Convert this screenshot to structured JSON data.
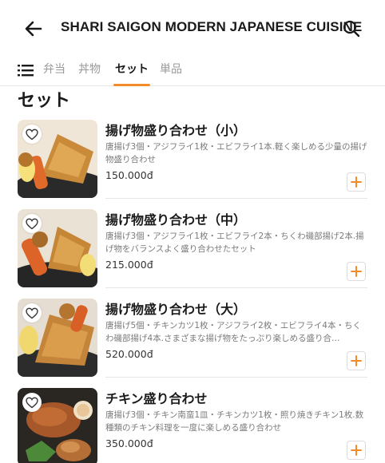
{
  "header": {
    "title": "SHARI SAIGON MODERN JAPANESE CUISINE",
    "back_icon": "arrow-left-icon",
    "search_icon": "search-icon"
  },
  "tabs": {
    "menu_icon": "list-menu-icon",
    "items": [
      {
        "label": "弁当",
        "active": false
      },
      {
        "label": "丼物",
        "active": false
      },
      {
        "label": "セット",
        "active": true
      },
      {
        "label": "単品",
        "active": false
      }
    ]
  },
  "accent_color": "#f28c28",
  "section": {
    "title": "セット",
    "items": [
      {
        "name": "揚げ物盛り合わせ（小）",
        "desc": "唐揚げ3個・アジフライ1枚・エビフライ1本.軽く楽しめる少量の揚げ物盛り合わせ",
        "price": "150.000đ"
      },
      {
        "name": "揚げ物盛り合わせ（中）",
        "desc": "唐揚げ3個・アジフライ1枚・エビフライ2本・ちくわ磯部揚げ2本.揚げ物をバランスよく盛り合わせたセット",
        "price": "215.000đ"
      },
      {
        "name": "揚げ物盛り合わせ（大）",
        "desc": "唐揚げ5個・チキンカツ1枚・アジフライ2枚・エビフライ4本・ちくわ磯部揚げ4本.さまざまな揚げ物をたっぷり楽しめる盛り合…",
        "price": "520.000đ"
      },
      {
        "name": "チキン盛り合わせ",
        "desc": "唐揚げ3個・チキン南蛮1皿・チキンカツ1枚・照り焼きチキン1枚.数種類のチキン料理を一度に楽しめる盛り合わせ",
        "price": "350.000đ"
      }
    ]
  }
}
